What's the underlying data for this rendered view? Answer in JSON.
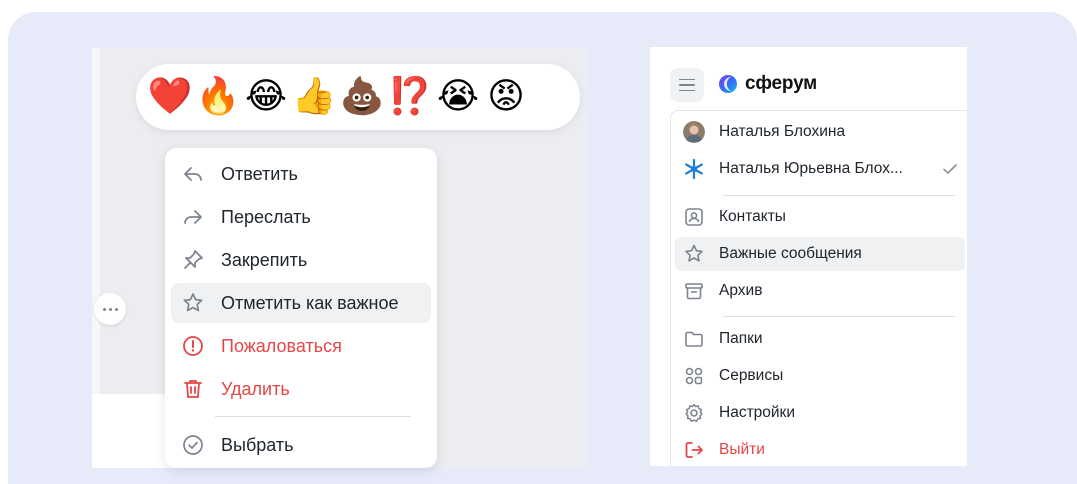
{
  "left": {
    "reactions": [
      {
        "icon": "red-heart-emoji",
        "glyph": "❤️"
      },
      {
        "icon": "fire-emoji",
        "glyph": "🔥"
      },
      {
        "icon": "tears-of-joy-emoji",
        "glyph": "😂"
      },
      {
        "icon": "thumbs-up-emoji",
        "glyph": "👍"
      },
      {
        "icon": "pile-of-poo-emoji",
        "glyph": "💩"
      },
      {
        "icon": "question-marks-emoji",
        "glyph": "⁉️"
      },
      {
        "icon": "crying-face-emoji",
        "glyph": "😭"
      },
      {
        "icon": "angry-face-emoji",
        "glyph": "😡"
      }
    ],
    "menu": {
      "reply": "Ответить",
      "forward": "Переслать",
      "pin": "Закрепить",
      "mark_important": "Отметить как важное",
      "report": "Пожаловаться",
      "delete": "Удалить",
      "select": "Выбрать"
    }
  },
  "right": {
    "brand": "сферум",
    "accounts": {
      "account_1": "Наталья Блохина",
      "account_2": "Наталья Юрьевна Блох..."
    },
    "menu": {
      "contacts": "Контакты",
      "important": "Важные сообщения",
      "archive": "Архив",
      "folders": "Папки",
      "services": "Сервисы",
      "settings": "Настройки",
      "logout": "Выйти"
    }
  },
  "colors": {
    "frame_bg": "#e6eaf9",
    "text": "#20262d",
    "danger": "#e64646",
    "icon_gray": "#7d8490",
    "highlight": "#f0f1f3"
  }
}
